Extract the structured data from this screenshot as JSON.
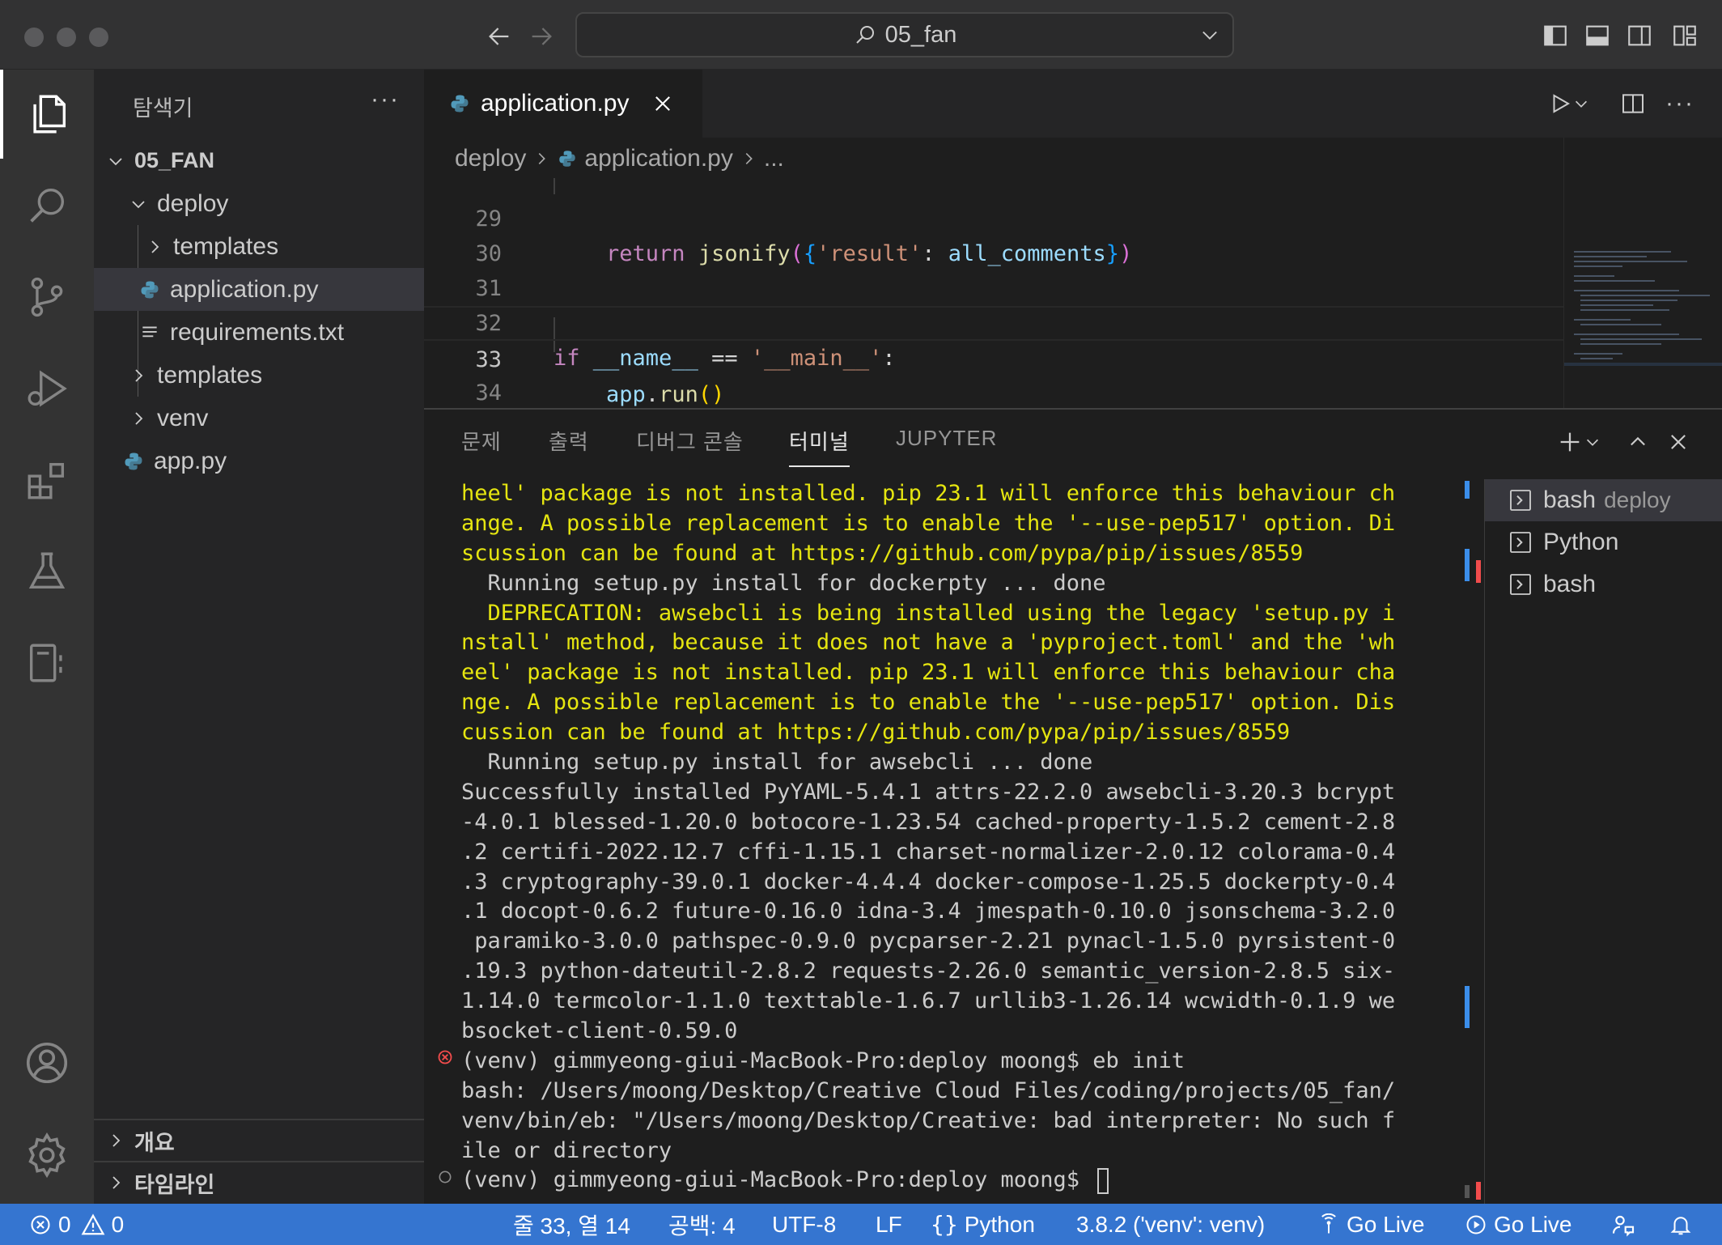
{
  "titlebar": {
    "search_label": "05_fan"
  },
  "explorer": {
    "title": "탐색기",
    "root": "05_FAN",
    "items": [
      {
        "label": "deploy"
      },
      {
        "label": "templates"
      },
      {
        "label": "application.py"
      },
      {
        "label": "requirements.txt"
      },
      {
        "label": "templates"
      },
      {
        "label": "venv"
      },
      {
        "label": "app.py"
      }
    ],
    "sections": [
      "개요",
      "타임라인"
    ]
  },
  "editor": {
    "tab_label": "application.py",
    "breadcrumb": [
      "deploy",
      "application.py",
      "..."
    ],
    "lines": [
      {
        "num": "29",
        "text": "    return jsonify({'result': all_comments})"
      },
      {
        "num": "30",
        "text": ""
      },
      {
        "num": "31",
        "text": ""
      },
      {
        "num": "32",
        "text": "if __name__ == '__main__':"
      },
      {
        "num": "33",
        "text": "    app.run()"
      },
      {
        "num": "34",
        "text": ""
      }
    ]
  },
  "panel": {
    "tabs": [
      "문제",
      "출력",
      "디버그 콘솔",
      "터미널",
      "JUPYTER"
    ],
    "active_tab": "터미널",
    "terminal_lines": [
      "heel' package is not installed. pip 23.1 will enforce this behaviour ch",
      "ange. A possible replacement is to enable the '--use-pep517' option. Di",
      "scussion can be found at https://github.com/pypa/pip/issues/8559",
      "  Running setup.py install for dockerpty ... done",
      "  DEPRECATION: awsebcli is being installed using the legacy 'setup.py i",
      "nstall' method, because it does not have a 'pyproject.toml' and the 'wh",
      "eel' package is not installed. pip 23.1 will enforce this behaviour cha",
      "nge. A possible replacement is to enable the '--use-pep517' option. Dis",
      "cussion can be found at https://github.com/pypa/pip/issues/8559",
      "  Running setup.py install for awsebcli ... done",
      "Successfully installed PyYAML-5.4.1 attrs-22.2.0 awsebcli-3.20.3 bcrypt",
      "-4.0.1 blessed-1.20.0 botocore-1.23.54 cached-property-1.5.2 cement-2.8",
      ".2 certifi-2022.12.7 cffi-1.15.1 charset-normalizer-2.0.12 colorama-0.4",
      ".3 cryptography-39.0.1 docker-4.4.4 docker-compose-1.25.5 dockerpty-0.4",
      ".1 docopt-0.6.2 future-0.16.0 idna-3.4 jmespath-0.10.0 jsonschema-3.2.0",
      " paramiko-3.0.0 pathspec-0.9.0 pycparser-2.21 pynacl-1.5.0 pyrsistent-0",
      ".19.3 python-dateutil-2.8.2 requests-2.26.0 semantic_version-2.8.5 six-",
      "1.14.0 termcolor-1.1.0 texttable-1.6.7 urllib3-1.26.14 wcwidth-0.1.9 we",
      "bsocket-client-0.59.0",
      "(venv) gimmyeong-giui-MacBook-Pro:deploy moong$ eb init",
      "bash: /Users/moong/Desktop/Creative Cloud Files/coding/projects/05_fan/",
      "venv/bin/eb: \"/Users/moong/Desktop/Creative: bad interpreter: No such f",
      "ile or directory",
      "(venv) gimmyeong-giui-MacBook-Pro:deploy moong$ "
    ],
    "terminals": [
      {
        "name": "bash",
        "desc": "deploy"
      },
      {
        "name": "Python",
        "desc": ""
      },
      {
        "name": "bash",
        "desc": ""
      }
    ]
  },
  "statusbar": {
    "errors": "0",
    "warnings": "0",
    "position": "줄 33, 열 14",
    "spaces": "공백: 4",
    "encoding": "UTF-8",
    "eol": "LF",
    "language": "Python",
    "interpreter": "3.8.2 ('venv': venv)",
    "golive1": "Go Live",
    "golive2": "Go Live"
  },
  "colors": {
    "accent": "#3575d0",
    "warning_text": "#e5e510",
    "python_icon": "#519aba"
  }
}
